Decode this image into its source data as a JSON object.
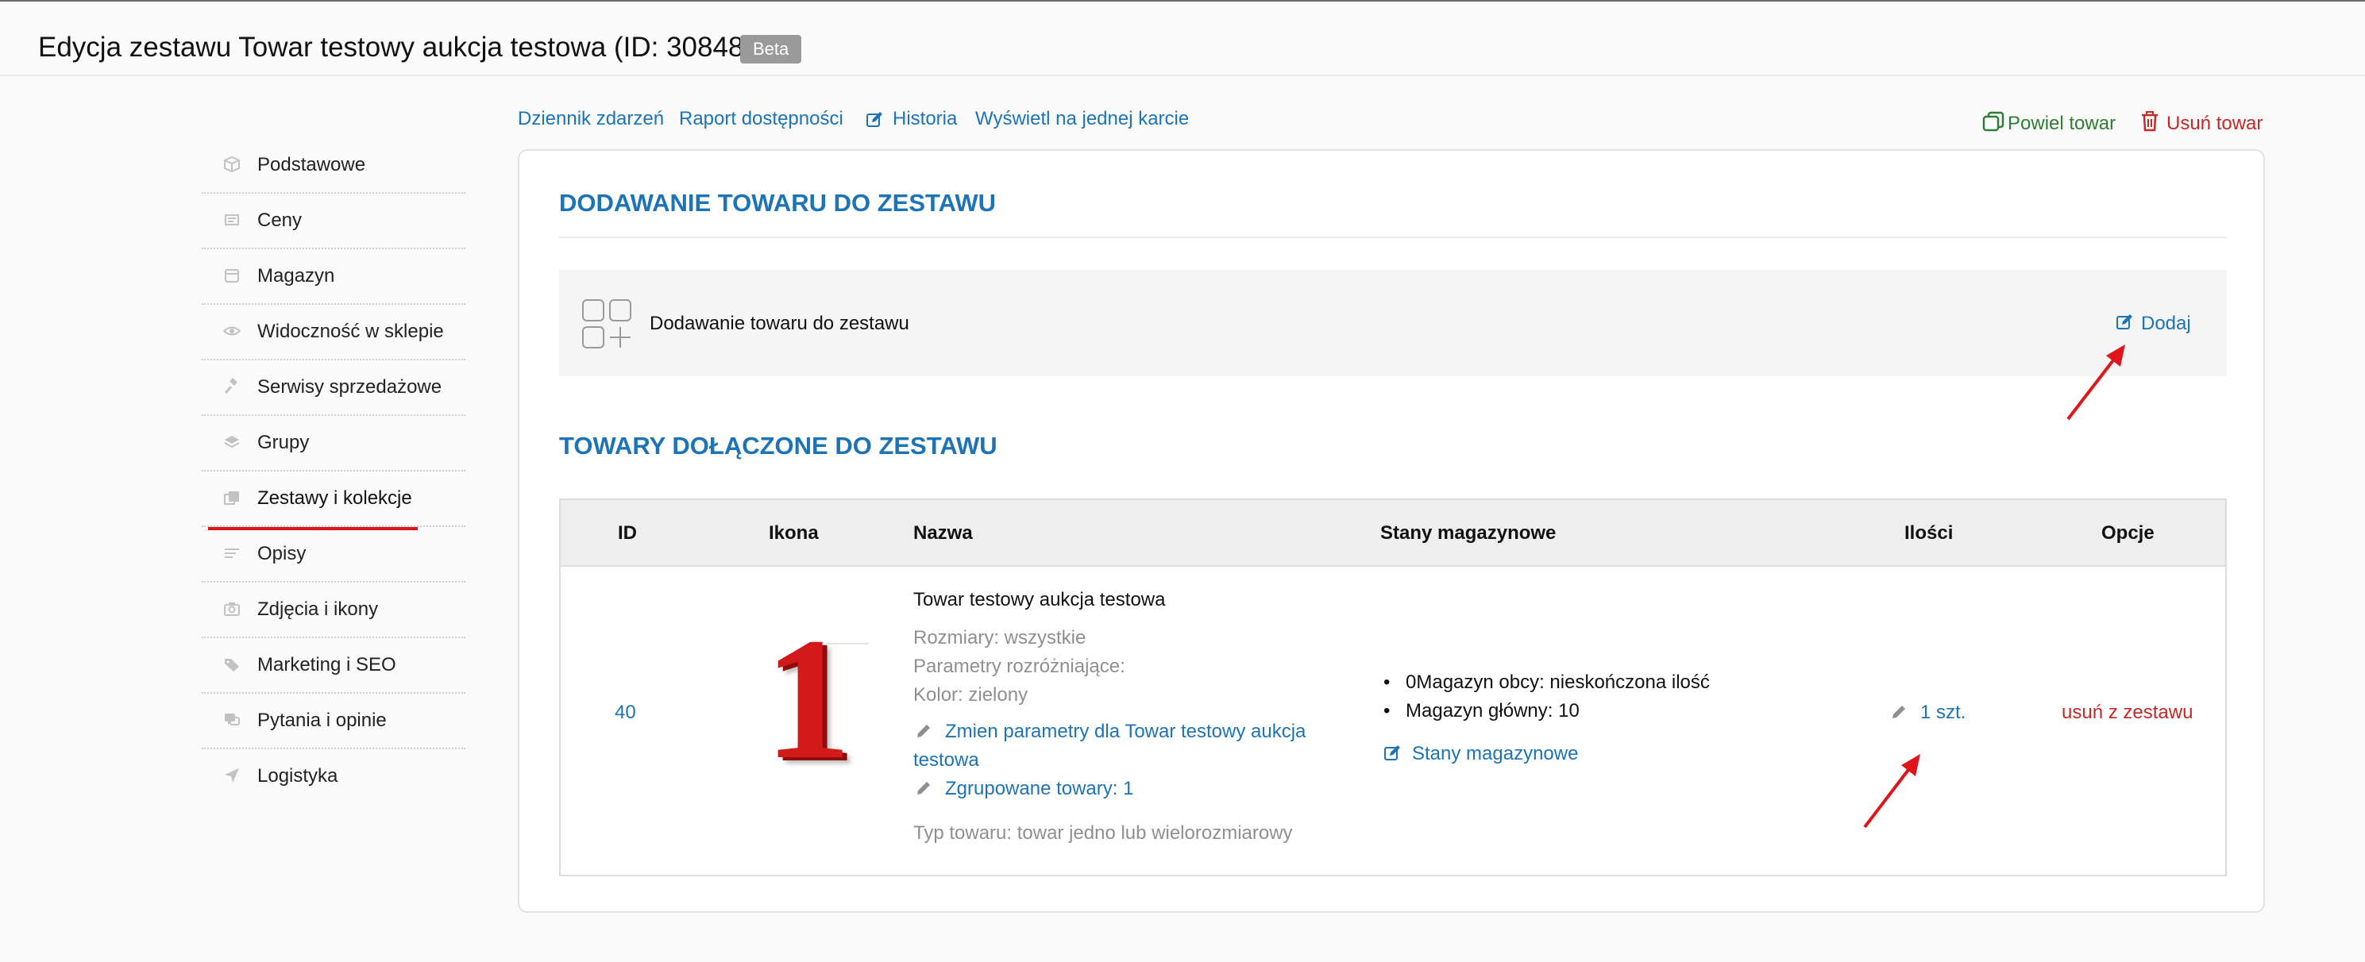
{
  "header": {
    "title": "Edycja zestawu Towar testowy aukcja testowa (ID: 30848)",
    "badge": "Beta"
  },
  "sidebar": {
    "items": [
      {
        "label": "Podstawowe",
        "icon": "cube-icon"
      },
      {
        "label": "Ceny",
        "icon": "price-icon"
      },
      {
        "label": "Magazyn",
        "icon": "box-icon"
      },
      {
        "label": "Widoczność w sklepie",
        "icon": "eye-icon"
      },
      {
        "label": "Serwisy sprzedażowe",
        "icon": "gavel-icon"
      },
      {
        "label": "Grupy",
        "icon": "layers-icon"
      },
      {
        "label": "Zestawy i kolekcje",
        "icon": "sets-icon",
        "active": true
      },
      {
        "label": "Opisy",
        "icon": "description-icon"
      },
      {
        "label": "Zdjęcia i ikony",
        "icon": "camera-icon"
      },
      {
        "label": "Marketing i SEO",
        "icon": "tags-icon"
      },
      {
        "label": "Pytania i opinie",
        "icon": "comments-icon"
      },
      {
        "label": "Logistyka",
        "icon": "send-icon"
      }
    ]
  },
  "toolbar": {
    "events_log": "Dziennik zdarzeń",
    "availability_report": "Raport dostępności",
    "history": "Historia",
    "single_card": "Wyświetl na jednej karcie",
    "duplicate": "Powiel towar",
    "delete": "Usuń towar"
  },
  "add_section": {
    "title": "DODAWANIE TOWARU DO ZESTAWU",
    "row_label": "Dodawanie towaru do zestawu",
    "add_button": "Dodaj"
  },
  "included_section": {
    "title": "TOWARY DOŁĄCZONE DO ZESTAWU",
    "columns": [
      "ID",
      "Ikona",
      "Nazwa",
      "Stany magazynowe",
      "Ilości",
      "Opcje"
    ],
    "rows": [
      {
        "id": "40",
        "icon_glyph": "1",
        "name": "Towar testowy aukcja testowa",
        "sizes": "Rozmiary: wszystkie",
        "params": "Parametry rozróżniające:",
        "color": "Kolor: zielony",
        "change_params_line1": "Zmien parametry dla Towar testowy aukcja",
        "change_params_line2": "testowa",
        "grouped": "Zgrupowane towary: 1",
        "type": "Typ towaru: towar jedno lub wielorozmiarowy",
        "stock": [
          "0Magazyn obcy: nieskończona ilość",
          "Magazyn główny: 10"
        ],
        "stock_link": "Stany magazynowe",
        "quantity": "1 szt.",
        "remove": "usuń z zestawu"
      }
    ]
  },
  "colors": {
    "link_blue": "#1c73b5",
    "danger_red": "#c62828",
    "success_green": "#2e7d32",
    "annotation_red": "#e0151c"
  }
}
